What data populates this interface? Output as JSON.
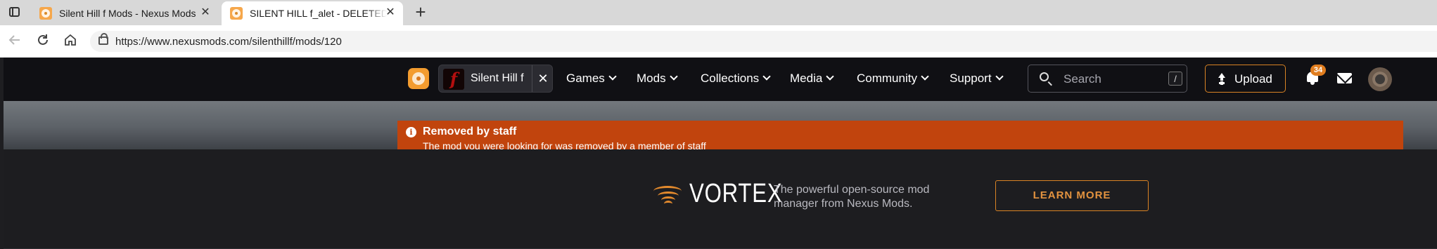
{
  "browser": {
    "tabs": [
      {
        "title": "Silent Hill f Mods - Nexus Mods",
        "active": false
      },
      {
        "title": "SILENT HILL f_alet - DELETED at Silent Hill f Nexus - Mods and Community",
        "active": true
      }
    ],
    "tab_close_glyph": "✕",
    "new_tab_glyph": "+",
    "url": "https://www.nexusmods.com/silenthillf/mods/120",
    "nav_icons": [
      "back-arrow-icon",
      "reload-icon",
      "home-icon",
      "lock-icon"
    ]
  },
  "site_nav": {
    "game_name": "Silent Hill f",
    "game_thumb_letter": "f",
    "clear_glyph": "✕",
    "links": [
      "Games",
      "Mods",
      "Collections",
      "Media",
      "Community",
      "Support"
    ],
    "search_placeholder": "Search",
    "search_shortcut": "/",
    "upload_label": "Upload",
    "notification_count": "34"
  },
  "alert": {
    "title": "Removed by staff",
    "message": "The mod you were looking for was removed by a member of staff",
    "icon_glyph": "i"
  },
  "promo": {
    "brand": "VORTEX",
    "description": "The powerful open-source mod manager from Nexus Mods.",
    "button_label": "LEARN MORE"
  },
  "colors": {
    "accent_orange": "#d98324",
    "alert_bg": "#c1440d",
    "nav_bg": "#101014",
    "page_bg": "#1d1d20"
  }
}
